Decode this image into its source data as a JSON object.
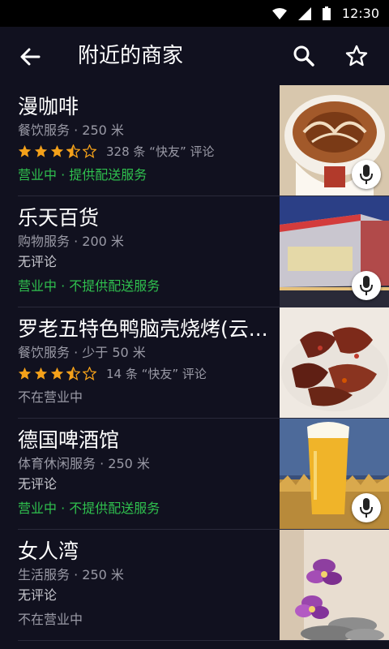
{
  "status_bar": {
    "time": "12:30"
  },
  "header": {
    "title": "附近的商家"
  },
  "colors": {
    "background": "#11111f",
    "open_status": "#2fc04e",
    "star": "#f4a11a",
    "muted_text": "#9a9aa6"
  },
  "merchants": [
    {
      "name": "漫咖啡",
      "meta": "餐饮服务 · 250 米",
      "rating": 3.5,
      "review_text": "328 条 “快友” 评论",
      "status": "营业中 · 提供配送服务",
      "has_mic": true,
      "image": "latte-art-photo"
    },
    {
      "name": "乐天百货",
      "meta": "购物服务 · 200 米",
      "review_text": "无评论",
      "status": "营业中 · 不提供配送服务",
      "has_mic": true,
      "image": "department-store-photo"
    },
    {
      "name": "罗老五特色鸭脑壳烧烤(云...",
      "meta": "餐饮服务 · 少于 50 米",
      "rating": 3.5,
      "review_text": "14 条 “快友” 评论",
      "status": "不在营业中",
      "has_mic": false,
      "image": "duck-head-dish-photo"
    },
    {
      "name": "德国啤酒馆",
      "meta": "体育休闲服务 · 250 米",
      "review_text": "无评论",
      "status": "营业中 · 不提供配送服务",
      "has_mic": true,
      "image": "beer-glass-photo"
    },
    {
      "name": "女人湾",
      "meta": "生活服务 · 250 米",
      "review_text": "无评论",
      "status": "不在营业中",
      "has_mic": false,
      "image": "orchid-spa-photo"
    }
  ]
}
